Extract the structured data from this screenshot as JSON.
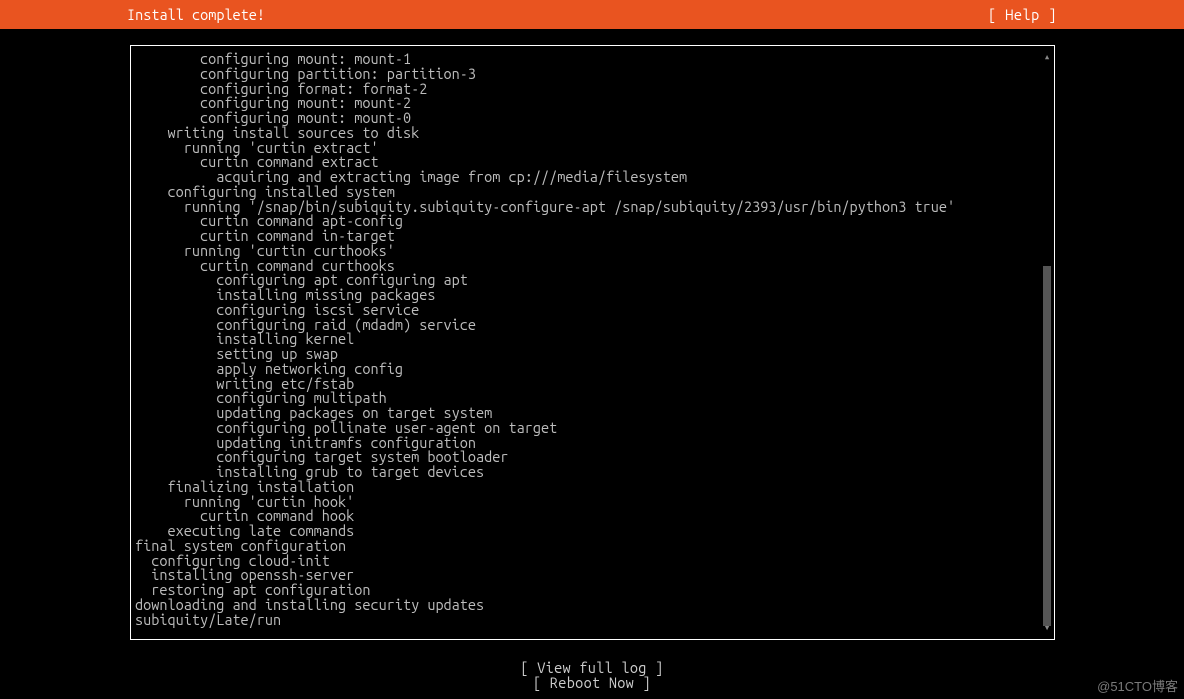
{
  "header": {
    "title": "Install complete!",
    "help_label": "[ Help ]"
  },
  "log": {
    "lines": [
      {
        "indent": 8,
        "text": "configuring mount: mount-1"
      },
      {
        "indent": 8,
        "text": "configuring partition: partition-3"
      },
      {
        "indent": 8,
        "text": "configuring format: format-2"
      },
      {
        "indent": 8,
        "text": "configuring mount: mount-2"
      },
      {
        "indent": 8,
        "text": "configuring mount: mount-0"
      },
      {
        "indent": 4,
        "text": "writing install sources to disk"
      },
      {
        "indent": 6,
        "text": "running 'curtin extract'"
      },
      {
        "indent": 8,
        "text": "curtin command extract"
      },
      {
        "indent": 10,
        "text": "acquiring and extracting image from cp:///media/filesystem"
      },
      {
        "indent": 4,
        "text": "configuring installed system"
      },
      {
        "indent": 6,
        "text": "running '/snap/bin/subiquity.subiquity-configure-apt /snap/subiquity/2393/usr/bin/python3 true'"
      },
      {
        "indent": 8,
        "text": "curtin command apt-config"
      },
      {
        "indent": 8,
        "text": "curtin command in-target"
      },
      {
        "indent": 6,
        "text": "running 'curtin curthooks'"
      },
      {
        "indent": 8,
        "text": "curtin command curthooks"
      },
      {
        "indent": 10,
        "text": "configuring apt configuring apt"
      },
      {
        "indent": 10,
        "text": "installing missing packages"
      },
      {
        "indent": 10,
        "text": "configuring iscsi service"
      },
      {
        "indent": 10,
        "text": "configuring raid (mdadm) service"
      },
      {
        "indent": 10,
        "text": "installing kernel"
      },
      {
        "indent": 10,
        "text": "setting up swap"
      },
      {
        "indent": 10,
        "text": "apply networking config"
      },
      {
        "indent": 10,
        "text": "writing etc/fstab"
      },
      {
        "indent": 10,
        "text": "configuring multipath"
      },
      {
        "indent": 10,
        "text": "updating packages on target system"
      },
      {
        "indent": 10,
        "text": "configuring pollinate user-agent on target"
      },
      {
        "indent": 10,
        "text": "updating initramfs configuration"
      },
      {
        "indent": 10,
        "text": "configuring target system bootloader"
      },
      {
        "indent": 10,
        "text": "installing grub to target devices"
      },
      {
        "indent": 4,
        "text": "finalizing installation"
      },
      {
        "indent": 6,
        "text": "running 'curtin hook'"
      },
      {
        "indent": 8,
        "text": "curtin command hook"
      },
      {
        "indent": 4,
        "text": "executing late commands"
      },
      {
        "indent": 0,
        "text": "final system configuration"
      },
      {
        "indent": 2,
        "text": "configuring cloud-init"
      },
      {
        "indent": 2,
        "text": "installing openssh-server"
      },
      {
        "indent": 2,
        "text": "restoring apt configuration"
      },
      {
        "indent": 0,
        "text": "downloading and installing security updates"
      },
      {
        "indent": 0,
        "text": "subiquity/Late/run"
      }
    ]
  },
  "footer": {
    "view_log_label": "[ View full log ]",
    "reboot_label": "[ Reboot Now    ]"
  },
  "watermark": "@51CTO博客"
}
